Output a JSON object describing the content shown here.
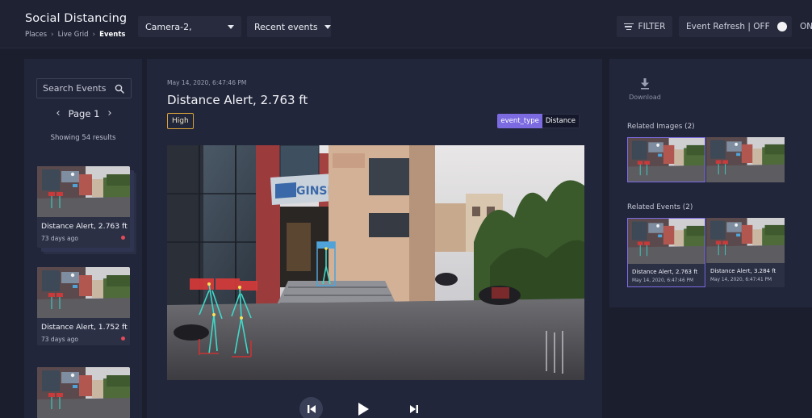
{
  "header": {
    "app_title": "Social Distancing",
    "breadcrumb": [
      "Places",
      "Live Grid",
      "Events"
    ],
    "camera_select": "Camera-2,",
    "events_select": "Recent events",
    "filter_label": "FILTER",
    "refresh_label": "Event Refresh | OFF",
    "refresh_on_label": "ON"
  },
  "sidebar": {
    "search_placeholder": "Search Events",
    "page_label": "Page 1",
    "results_text": "Showing 54 results",
    "cards": [
      {
        "title": "Distance Alert, 2.763 ft",
        "time": "73 days ago"
      },
      {
        "title": "Distance Alert, 1.752 ft",
        "time": "73 days ago"
      },
      {
        "title": "",
        "time": ""
      }
    ]
  },
  "event": {
    "date": "May 14, 2020, 6:47:46 PM",
    "title": "Distance Alert, 2.763 ft",
    "severity": "High",
    "tag_key": "event_type",
    "tag_value": "Distance",
    "sign_text": "GINSERV"
  },
  "details": {
    "download_label": "Download",
    "related_images_title": "Related Images  (2)",
    "related_events_title": "Related Events  (2)",
    "related_events": [
      {
        "title": "Distance Alert, 2.763 ft",
        "date": "May 14, 2020, 6:47:46 PM"
      },
      {
        "title": "Distance Alert, 3.284 ft",
        "date": "May 14, 2020, 6:47:41 PM"
      }
    ]
  },
  "icons": {
    "search": "search-icon",
    "filter": "filter-icon",
    "download": "download-icon",
    "prev": "skip-previous-icon",
    "play": "play-icon",
    "next": "skip-next-icon"
  },
  "colors": {
    "background": "#1b1e2d",
    "panel": "#22263a",
    "accent": "#7b6ae0",
    "severity_high": "#d9a23a",
    "alert_dot": "#e34a5b",
    "skeleton": "#3fd9c8"
  }
}
